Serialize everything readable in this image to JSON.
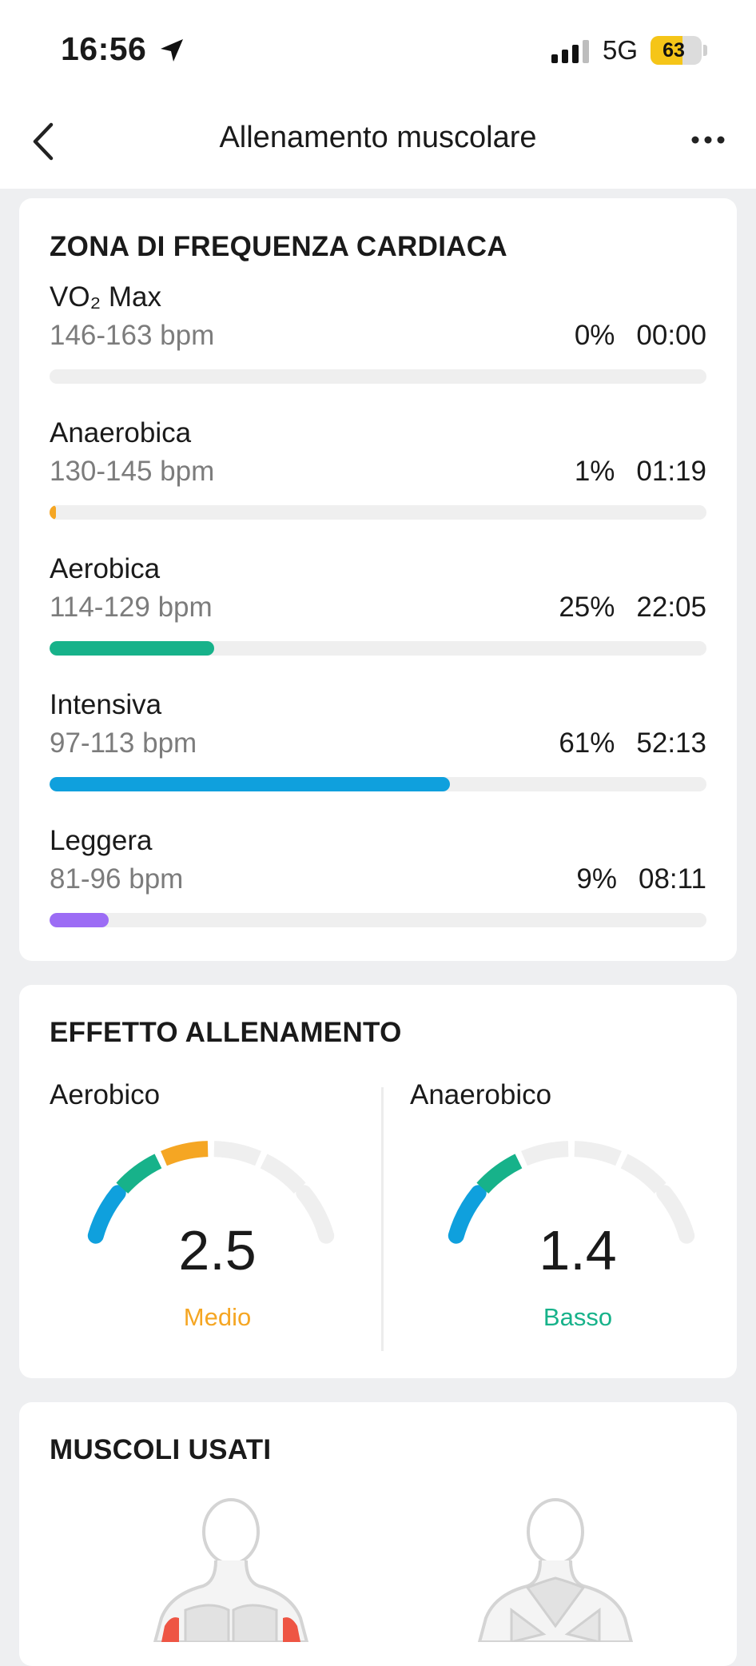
{
  "status_bar": {
    "time": "16:56",
    "network": "5G",
    "battery": "63",
    "battery_level": 0.63
  },
  "nav": {
    "title": "Allenamento muscolare"
  },
  "heart_zones": {
    "title": "ZONA DI FREQUENZA CARDIACA",
    "zones": [
      {
        "name": "VO₂ Max",
        "range": "146-163 bpm",
        "percent": "0%",
        "time": "00:00",
        "fraction": 0.0,
        "color": "#f5a623"
      },
      {
        "name": "Anaerobica",
        "range": "130-145 bpm",
        "percent": "1%",
        "time": "01:19",
        "fraction": 0.01,
        "color": "#f5a623"
      },
      {
        "name": "Aerobica",
        "range": "114-129 bpm",
        "percent": "25%",
        "time": "22:05",
        "fraction": 0.25,
        "color": "#17b28a"
      },
      {
        "name": "Intensiva",
        "range": "97-113 bpm",
        "percent": "61%",
        "time": "52:13",
        "fraction": 0.61,
        "color": "#0fa0dd"
      },
      {
        "name": "Leggera",
        "range": "81-96 bpm",
        "percent": "9%",
        "time": "08:11",
        "fraction": 0.09,
        "color": "#9c6cf5"
      }
    ]
  },
  "training_effect": {
    "title": "EFFETTO ALLENAMENTO",
    "aerobic": {
      "label": "Aerobico",
      "value": "2.5",
      "level": "Medio",
      "level_color": "#f5a623",
      "active_segments": 3
    },
    "anaerobic": {
      "label": "Anaerobico",
      "value": "1.4",
      "level": "Basso",
      "level_color": "#17b28a",
      "active_segments": 2
    },
    "segment_colors": [
      "#0fa0dd",
      "#17b28a",
      "#f5a623",
      "#efefef",
      "#efefef",
      "#efefef"
    ]
  },
  "muscles": {
    "title": "MUSCOLI USATI"
  }
}
